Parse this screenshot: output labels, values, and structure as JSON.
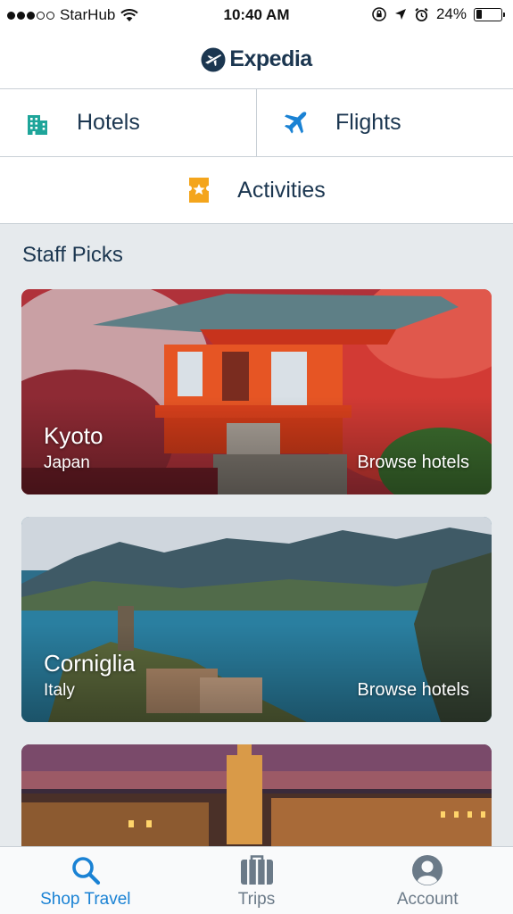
{
  "status_bar": {
    "carrier": "StarHub",
    "signal_bars_filled": 3,
    "signal_bars_total": 5,
    "time": "10:40 AM",
    "battery_percent": "24%"
  },
  "header": {
    "logo_text": "Expedia"
  },
  "categories": {
    "hotels_label": "Hotels",
    "flights_label": "Flights",
    "activities_label": "Activities"
  },
  "staff_picks": {
    "title": "Staff Picks",
    "cards": [
      {
        "city": "Kyoto",
        "country": "Japan",
        "action": "Browse hotels"
      },
      {
        "city": "Corniglia",
        "country": "Italy",
        "action": "Browse hotels"
      }
    ]
  },
  "tab_bar": {
    "tabs": [
      {
        "label": "Shop Travel",
        "icon": "search-icon",
        "active": true
      },
      {
        "label": "Trips",
        "icon": "suitcase-icon",
        "active": false
      },
      {
        "label": "Account",
        "icon": "account-icon",
        "active": false
      }
    ]
  },
  "colors": {
    "brand_navy": "#1b3650",
    "accent_blue": "#1a82d4",
    "hotels_teal": "#1ea59a",
    "activities_orange": "#f4a51c"
  }
}
